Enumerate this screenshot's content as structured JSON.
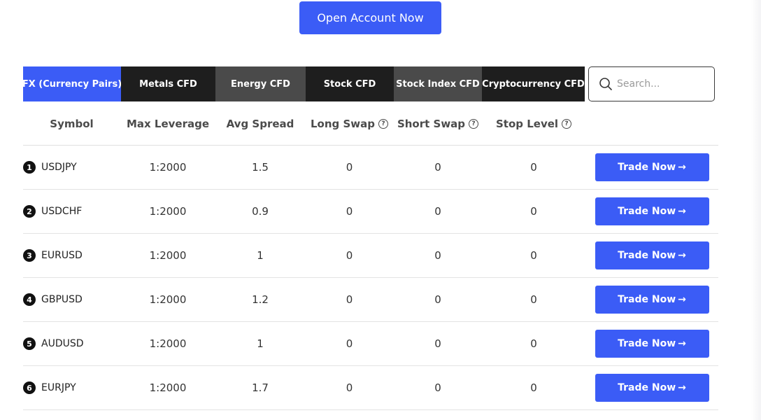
{
  "cta": {
    "label": "Open Account Now"
  },
  "tabs": [
    {
      "label": "FX (Currency Pairs)"
    },
    {
      "label": "Metals CFD"
    },
    {
      "label": "Energy CFD"
    },
    {
      "label": "Stock CFD"
    },
    {
      "label": "Stock Index CFD"
    },
    {
      "label": "Cryptocurrency CFD"
    }
  ],
  "search": {
    "placeholder": "Search..."
  },
  "columns": {
    "symbol": "Symbol",
    "max_leverage": "Max Leverage",
    "avg_spread": "Avg Spread",
    "long_swap": "Long Swap",
    "short_swap": "Short Swap",
    "stop_level": "Stop Level",
    "info_icon_glyph": "?"
  },
  "rows": [
    {
      "rank": "1",
      "symbol": "USDJPY",
      "max_leverage": "1:2000",
      "avg_spread": "1.5",
      "long_swap": "0",
      "short_swap": "0",
      "stop_level": "0",
      "action": "Trade Now"
    },
    {
      "rank": "2",
      "symbol": "USDCHF",
      "max_leverage": "1:2000",
      "avg_spread": "0.9",
      "long_swap": "0",
      "short_swap": "0",
      "stop_level": "0",
      "action": "Trade Now"
    },
    {
      "rank": "3",
      "symbol": "EURUSD",
      "max_leverage": "1:2000",
      "avg_spread": "1",
      "long_swap": "0",
      "short_swap": "0",
      "stop_level": "0",
      "action": "Trade Now"
    },
    {
      "rank": "4",
      "symbol": "GBPUSD",
      "max_leverage": "1:2000",
      "avg_spread": "1.2",
      "long_swap": "0",
      "short_swap": "0",
      "stop_level": "0",
      "action": "Trade Now"
    },
    {
      "rank": "5",
      "symbol": "AUDUSD",
      "max_leverage": "1:2000",
      "avg_spread": "1",
      "long_swap": "0",
      "short_swap": "0",
      "stop_level": "0",
      "action": "Trade Now"
    },
    {
      "rank": "6",
      "symbol": "EURJPY",
      "max_leverage": "1:2000",
      "avg_spread": "1.7",
      "long_swap": "0",
      "short_swap": "0",
      "stop_level": "0",
      "action": "Trade Now"
    }
  ],
  "icons": {
    "search": "search-icon",
    "info": "question-circle-icon",
    "arrow": "arrow-right-icon"
  },
  "colors": {
    "accent": "#3b5cf6",
    "tab_dark": "#1e1e1e",
    "tab_grey": "#4a4a4a"
  }
}
